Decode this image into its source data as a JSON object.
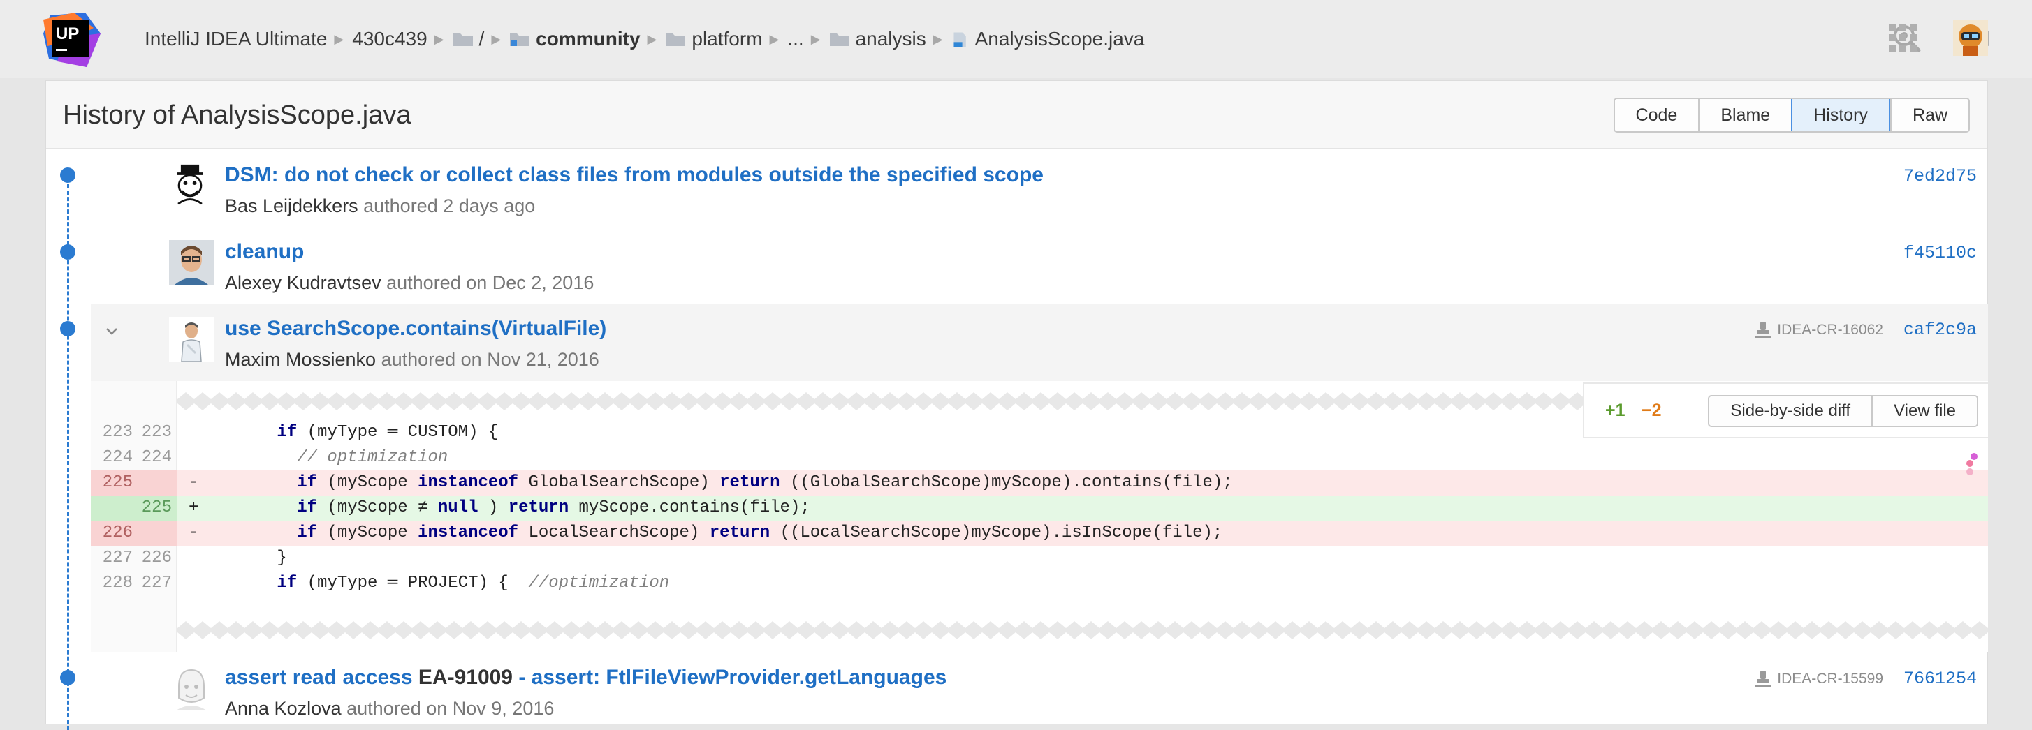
{
  "app": {
    "breadcrumb": {
      "product": "IntelliJ IDEA Ultimate",
      "revision": "430c439",
      "root": "/",
      "folder1": "community",
      "folder2": "platform",
      "ellipsis": "...",
      "folder3": "analysis",
      "file": "AnalysisScope.java"
    },
    "icons": [
      "upsource-logo",
      "search-icon",
      "hexagon-icon",
      "help-icon",
      "apps-grid-icon",
      "user-avatar"
    ]
  },
  "panel": {
    "title": "History of AnalysisScope.java",
    "tabs": [
      {
        "label": "Code",
        "active": false
      },
      {
        "label": "Blame",
        "active": false
      },
      {
        "label": "History",
        "active": true
      },
      {
        "label": "Raw",
        "active": false
      }
    ]
  },
  "commits": [
    {
      "title": "DSM: do not check or collect class files from modules outside the specified scope",
      "author": "Bas Leijdekkers",
      "when": "authored 2 days ago",
      "hash": "7ed2d75"
    },
    {
      "title": "cleanup",
      "author": "Alexey Kudravtsev",
      "when": "authored on Dec 2, 2016",
      "hash": "f45110c"
    },
    {
      "title": "use SearchScope.contains(VirtualFile)",
      "author": "Maxim Mossienko",
      "when": "authored on Nov 21, 2016",
      "review": "IDEA-CR-16062",
      "hash": "caf2c9a"
    },
    {
      "title_part1": "assert read access",
      "title_part2": "EA-91009",
      "title_part3": "- assert: FtlFileViewProvider.getLanguages",
      "author": "Anna Kozlova",
      "when": "authored on Nov 9, 2016",
      "review": "IDEA-CR-15599",
      "hash": "7661254"
    }
  ],
  "diff": {
    "added": "+1",
    "removed": "−2",
    "side_by_side_label": "Side-by-side diff",
    "view_file_label": "View file",
    "rows": [
      {
        "kind": "ctx",
        "old": "223",
        "new": "223",
        "mark": "",
        "indent": "      ",
        "parts": [
          [
            "kw",
            "if"
          ],
          [
            "",
            " (myType ═ CUSTOM) {"
          ]
        ]
      },
      {
        "kind": "ctx",
        "old": "224",
        "new": "224",
        "mark": "",
        "indent": "        ",
        "parts": [
          [
            "cm",
            "// optimization"
          ]
        ]
      },
      {
        "kind": "del",
        "old": "225",
        "new": "",
        "mark": "-",
        "indent": "        ",
        "parts": [
          [
            "kw",
            "if"
          ],
          [
            "",
            " (myScope "
          ],
          [
            "kw",
            "instanceof"
          ],
          [
            "",
            " GlobalSearchScope) "
          ],
          [
            "kw",
            "return"
          ],
          [
            "",
            " ((GlobalSearchScope)myScope).contains(file);"
          ]
        ]
      },
      {
        "kind": "add",
        "old": "",
        "new": "225",
        "mark": "+",
        "indent": "        ",
        "parts": [
          [
            "kw",
            "if"
          ],
          [
            "",
            " (myScope ≠ "
          ],
          [
            "kw",
            "null"
          ],
          [
            "",
            " ) "
          ],
          [
            "kw",
            "return"
          ],
          [
            "",
            " myScope.contains(file);"
          ]
        ]
      },
      {
        "kind": "del",
        "old": "226",
        "new": "",
        "mark": "-",
        "indent": "        ",
        "parts": [
          [
            "kw",
            "if"
          ],
          [
            "",
            " (myScope "
          ],
          [
            "kw",
            "instanceof"
          ],
          [
            "",
            " LocalSearchScope) "
          ],
          [
            "kw",
            "return"
          ],
          [
            "",
            " ((LocalSearchScope)myScope).isInScope(file);"
          ]
        ]
      },
      {
        "kind": "ctx",
        "old": "227",
        "new": "226",
        "mark": "",
        "indent": "      ",
        "parts": [
          [
            "",
            "}"
          ]
        ]
      },
      {
        "kind": "ctx",
        "old": "228",
        "new": "227",
        "mark": "",
        "indent": "      ",
        "parts": [
          [
            "kw",
            "if"
          ],
          [
            "",
            " (myType ═ PROJECT) {  "
          ],
          [
            "cm",
            "//optimization"
          ]
        ]
      }
    ]
  },
  "colors": {
    "link": "#1f6fc4",
    "timeline": "#2b7bd1",
    "deleted_bg": "#fde8e8",
    "added_bg": "#e5f8e5",
    "added_count": "#5b9b2e",
    "removed_count": "#e07b18"
  }
}
